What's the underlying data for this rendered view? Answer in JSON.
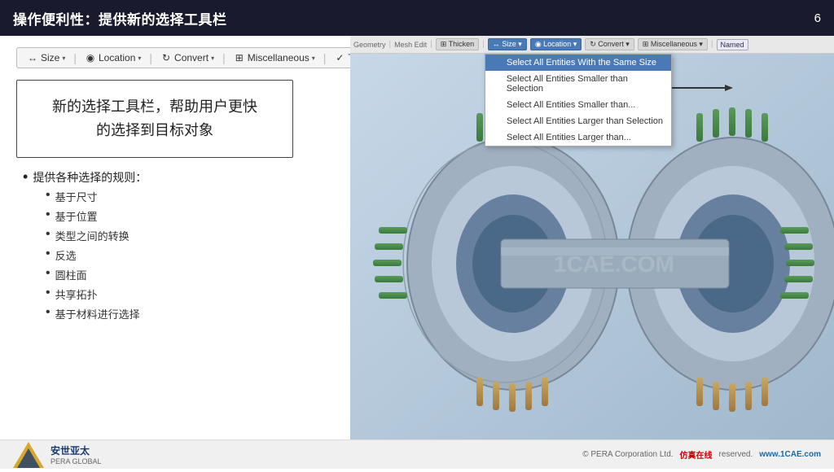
{
  "header": {
    "title": "操作便利性：提供新的选择工具栏",
    "slide_number": "6"
  },
  "toolbar": {
    "items": [
      {
        "label": "Size",
        "icon": "↔",
        "has_dropdown": true
      },
      {
        "label": "Location",
        "icon": "📍",
        "has_dropdown": true
      },
      {
        "label": "Convert",
        "icon": "🔄",
        "has_dropdown": true
      },
      {
        "label": "Miscellaneous",
        "icon": "⊙",
        "has_dropdown": true
      },
      {
        "label": "Tolerances",
        "icon": "✓",
        "has_dropdown": false
      }
    ]
  },
  "text_box": {
    "line1": "新的选择工具栏，帮助用户更快",
    "line2": "的选择到目标对象"
  },
  "bullets": {
    "main": "提供各种选择的规则：",
    "sub_items": [
      "基于尺寸",
      "基于位置",
      "类型之间的转换",
      "反选",
      "圆柱面",
      "共享拓扑",
      "基于材料进行选择"
    ]
  },
  "overlay_toolbar": {
    "items": [
      {
        "label": "Thicken",
        "active": false
      },
      {
        "label": "Size ▾",
        "active": true
      },
      {
        "label": "Location ▾",
        "active": true
      },
      {
        "label": "Convert ▾",
        "active": false
      },
      {
        "label": "Miscellaneous ▾",
        "active": false
      },
      {
        "label": "Named",
        "active": false
      }
    ],
    "secondary": [
      {
        "label": "Geometry"
      },
      {
        "label": "Mesh Edit"
      }
    ]
  },
  "dropdown_menu": {
    "items": [
      {
        "label": "Select All Entities With the Same Size",
        "checked": false,
        "active": true
      },
      {
        "label": "Select All Entities Smaller than Selection",
        "checked": false,
        "active": false
      },
      {
        "label": "Select All Entities Smaller than...",
        "checked": false,
        "active": false
      },
      {
        "label": "Select All Entities Larger than Selection",
        "checked": false,
        "active": false
      },
      {
        "label": "Select All Entities Larger than...",
        "checked": false,
        "active": false
      }
    ]
  },
  "footer": {
    "brand": "安世亚太",
    "sub_brand": "PERA GLOBAL",
    "copyright": "© PERA Corporation Ltd.",
    "watermark": "仿真在线",
    "url": "www.1CAE.com",
    "reserved": "reserved."
  },
  "icons": {
    "size_icon": "↔",
    "location_icon": "◉",
    "convert_icon": "↻",
    "misc_icon": "⊞",
    "tolerances_icon": "✓",
    "bullet": "•",
    "check": "✓"
  }
}
